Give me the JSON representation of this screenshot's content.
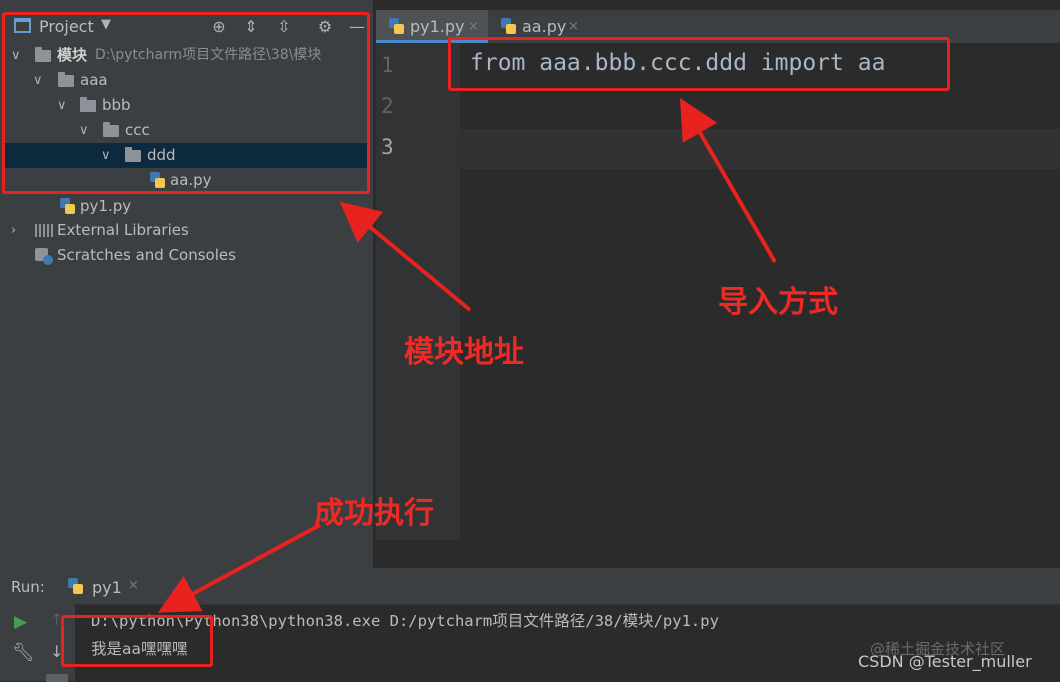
{
  "project_panel": {
    "title": "Project",
    "icons": [
      "project-view-icon",
      "chevron-down-icon",
      "locate-icon",
      "expand-all-icon",
      "collapse-all-icon",
      "gear-icon",
      "minimize-icon"
    ],
    "tree": {
      "root_name": "模块",
      "root_path": "D:\\pytcharm项目文件路径\\38\\模块",
      "aaa": "aaa",
      "bbb": "bbb",
      "ccc": "ccc",
      "ddd": "ddd",
      "aa_file": "aa.py",
      "py1_file": "py1.py",
      "external_libraries": "External Libraries",
      "scratches": "Scratches and Consoles"
    }
  },
  "editor": {
    "tabs": [
      {
        "label": "py1.py",
        "close": "×"
      },
      {
        "label": "aa.py",
        "close": "×"
      }
    ],
    "line_numbers": [
      "1",
      "2",
      "3"
    ],
    "code": "from aaa.bbb.ccc.ddd import aa"
  },
  "run_panel": {
    "label": "Run:",
    "tab_label": "py1",
    "tab_close": "×",
    "command_line": "D:\\python\\Python38\\python38.exe D:/pytcharm项目文件路径/38/模块/py1.py",
    "output_line": "我是aa嘿嘿嘿"
  },
  "annotations": {
    "module_address": "模块地址",
    "import_method": "导入方式",
    "success": "成功执行",
    "color": "#e8231f"
  },
  "watermark": {
    "line1": "@稀土掘金技术社区",
    "line2": "CSDN @Tester_muller"
  }
}
